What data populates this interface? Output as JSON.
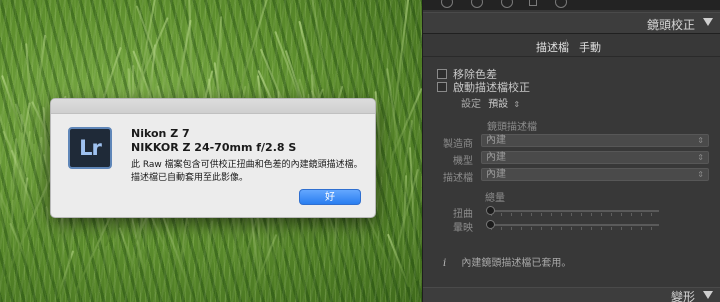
{
  "dialog": {
    "logo_text": "Lr",
    "line1": "Nikon Z 7",
    "line2": "NIKKOR Z 24-70mm f/2.8 S",
    "message": "此 Raw 檔案包含可供校正扭曲和色差的內建鏡頭描述檔。 描述檔已自動套用至此影像。",
    "ok_label": "好"
  },
  "panel": {
    "section_title": "鏡頭校正",
    "tabs": [
      "描述檔",
      "手動"
    ],
    "remove_ca_label": "移除色差",
    "enable_profile_label": "啟動描述檔校正",
    "setup_label": "設定",
    "setup_value": "預設",
    "profile_group_title": "鏡頭描述檔",
    "fields": [
      {
        "label": "製造商",
        "value": "內建"
      },
      {
        "label": "機型",
        "value": "內建"
      },
      {
        "label": "描述檔",
        "value": "內建"
      }
    ],
    "amount_title": "總量",
    "sliders": [
      {
        "label": "扭曲",
        "value": 0
      },
      {
        "label": "暈映",
        "value": 0
      }
    ],
    "info_icon": "i",
    "info_text": "內建鏡頭描述檔已套用。",
    "bottom_section_title": "變形"
  },
  "colors": {
    "panel_bg": "#383838",
    "dialog_bg": "#ececec",
    "ok_button": "#2a7ef0",
    "logo_border": "#5f86b8"
  }
}
